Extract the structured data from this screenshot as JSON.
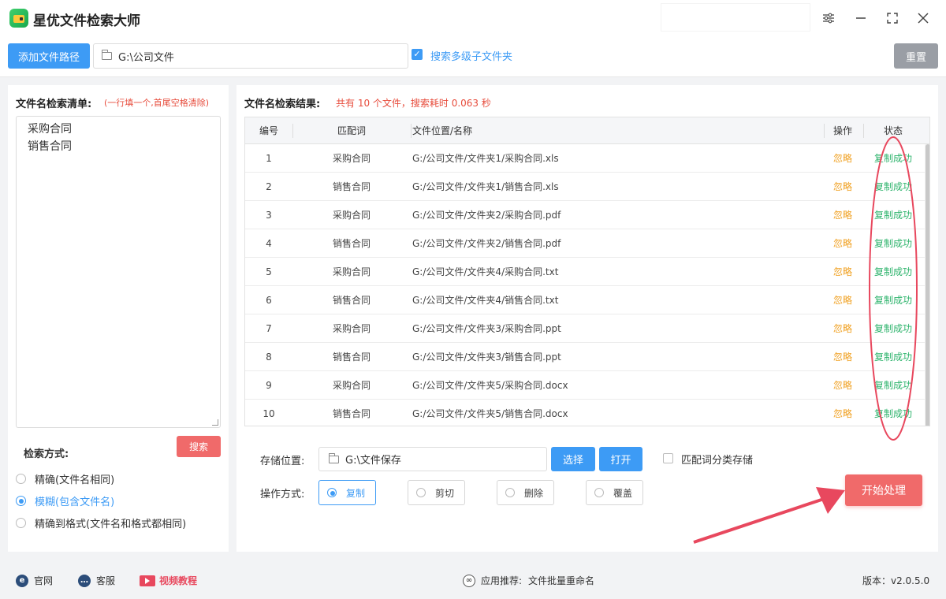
{
  "app": {
    "title": "星优文件检索大师"
  },
  "toolbar": {
    "add_path_label": "添加文件路径",
    "path_value": "G:\\公司文件",
    "subfolder_label": "搜索多级子文件夹",
    "subfolder_checked": true,
    "reset_label": "重置"
  },
  "left": {
    "title": "文件名检索清单:",
    "hint": "(一行填一个,首尾空格清除)",
    "keywords": [
      "采购合同",
      "销售合同"
    ],
    "search_mode_label": "检索方式:",
    "search_button": "搜索",
    "modes": [
      {
        "label": "精确(文件名相同)",
        "selected": false
      },
      {
        "label": "模糊(包含文件名)",
        "selected": true
      },
      {
        "label": "精确到格式(文件名和格式都相同)",
        "selected": false
      }
    ]
  },
  "results": {
    "title": "文件名检索结果:",
    "summary": "共有 10 个文件，搜索耗时 0.063 秒",
    "columns": {
      "no": "编号",
      "keyword": "匹配词",
      "path": "文件位置/名称",
      "op": "操作",
      "status": "状态"
    },
    "rows": [
      {
        "no": "1",
        "keyword": "采购合同",
        "path": "G:/公司文件/文件夹1/采购合同.xls",
        "op": "忽略",
        "status": "复制成功"
      },
      {
        "no": "2",
        "keyword": "销售合同",
        "path": "G:/公司文件/文件夹1/销售合同.xls",
        "op": "忽略",
        "status": "复制成功"
      },
      {
        "no": "3",
        "keyword": "采购合同",
        "path": "G:/公司文件/文件夹2/采购合同.pdf",
        "op": "忽略",
        "status": "复制成功"
      },
      {
        "no": "4",
        "keyword": "销售合同",
        "path": "G:/公司文件/文件夹2/销售合同.pdf",
        "op": "忽略",
        "status": "复制成功"
      },
      {
        "no": "5",
        "keyword": "采购合同",
        "path": "G:/公司文件/文件夹4/采购合同.txt",
        "op": "忽略",
        "status": "复制成功"
      },
      {
        "no": "6",
        "keyword": "销售合同",
        "path": "G:/公司文件/文件夹4/销售合同.txt",
        "op": "忽略",
        "status": "复制成功"
      },
      {
        "no": "7",
        "keyword": "采购合同",
        "path": "G:/公司文件/文件夹3/采购合同.ppt",
        "op": "忽略",
        "status": "复制成功"
      },
      {
        "no": "8",
        "keyword": "销售合同",
        "path": "G:/公司文件/文件夹3/销售合同.ppt",
        "op": "忽略",
        "status": "复制成功"
      },
      {
        "no": "9",
        "keyword": "采购合同",
        "path": "G:/公司文件/文件夹5/采购合同.docx",
        "op": "忽略",
        "status": "复制成功"
      },
      {
        "no": "10",
        "keyword": "销售合同",
        "path": "G:/公司文件/文件夹5/销售合同.docx",
        "op": "忽略",
        "status": "复制成功"
      }
    ]
  },
  "storage": {
    "label": "存储位置:",
    "value": "G:\\文件保存",
    "select_button": "选择",
    "open_button": "打开",
    "classify_label": "匹配词分类存储",
    "classify_checked": false
  },
  "operation": {
    "label": "操作方式:",
    "options": [
      {
        "label": "复制",
        "selected": true
      },
      {
        "label": "剪切",
        "selected": false
      },
      {
        "label": "删除",
        "selected": false
      },
      {
        "label": "覆盖",
        "selected": false
      }
    ],
    "start_button": "开始处理"
  },
  "footer": {
    "website": "官网",
    "service": "客服",
    "video": "视频教程",
    "recommend_label": "应用推荐:",
    "recommend_app": "文件批量重命名",
    "version": "版本：v2.0.5.0"
  },
  "colors": {
    "accent": "#3d9bf5",
    "danger": "#f06a6a",
    "success": "#2cb36b",
    "warning": "#f0a020",
    "annotation": "#e8485e"
  },
  "icons": [
    "app-logo-icon",
    "settings-sliders-icon",
    "minimize-icon",
    "maximize-icon",
    "close-icon",
    "folder-icon",
    "check-icon",
    "browser-e-icon",
    "chat-icon",
    "video-icon",
    "link-icon"
  ]
}
